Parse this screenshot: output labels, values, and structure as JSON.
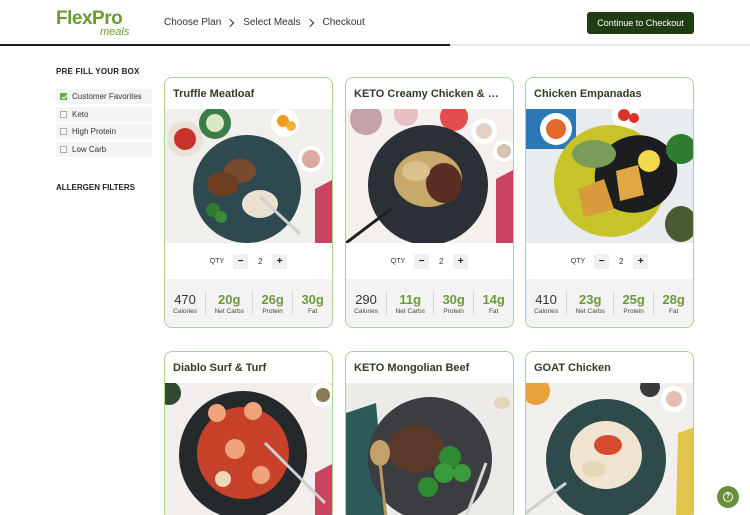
{
  "brand": {
    "logo_main": "FlexPro",
    "logo_sub": "meals"
  },
  "steps": [
    "Choose Plan",
    "Select Meals",
    "Checkout"
  ],
  "cta_label": "Continue to Checkout",
  "progress": 0.6,
  "sidebar": {
    "title": "PRE FILL YOUR BOX",
    "filters": [
      {
        "label": "Customer Favorites",
        "checked": true
      },
      {
        "label": "Keto",
        "checked": false
      },
      {
        "label": "High Protein",
        "checked": false
      },
      {
        "label": "Low Carb",
        "checked": false
      }
    ],
    "allergen_title": "ALLERGEN FILTERS"
  },
  "qty_label": "QTY",
  "meals": [
    {
      "title": "Truffle Meatloaf",
      "qty": "2",
      "calories": "470",
      "carbs": "20g",
      "protein": "26g",
      "fat": "30g",
      "plate": "#2f4a4f",
      "accent": "#8a5a3a"
    },
    {
      "title": "KETO Creamy Chicken & Bacon",
      "qty": "2",
      "calories": "290",
      "carbs": "11g",
      "protein": "30g",
      "fat": "14g",
      "plate": "#2b2f36",
      "accent": "#c9a96b"
    },
    {
      "title": "Chicken Empanadas",
      "qty": "2",
      "calories": "410",
      "carbs": "23g",
      "protein": "25g",
      "fat": "28g",
      "plate": "#1c1d1f",
      "accent": "#d89a3a"
    },
    {
      "title": "Diablo Surf & Turf",
      "qty": "",
      "calories": "",
      "carbs": "",
      "protein": "",
      "fat": "",
      "plate": "#26292c",
      "accent": "#c8412b"
    },
    {
      "title": "KETO Mongolian Beef",
      "qty": "",
      "calories": "",
      "carbs": "",
      "protein": "",
      "fat": "",
      "plate": "#3b3d40",
      "accent": "#5a3a2a"
    },
    {
      "title": "GOAT Chicken",
      "qty": "",
      "calories": "",
      "carbs": "",
      "protein": "",
      "fat": "",
      "plate": "#2e4a4a",
      "accent": "#f0e4d0"
    }
  ],
  "nutrient_labels": {
    "calories": "Calories",
    "carbs": "Net Carbs",
    "protein": "Protein",
    "fat": "Fat"
  },
  "nutrient_labels_card2_fat": "Fat",
  "help_icon": "question-icon"
}
